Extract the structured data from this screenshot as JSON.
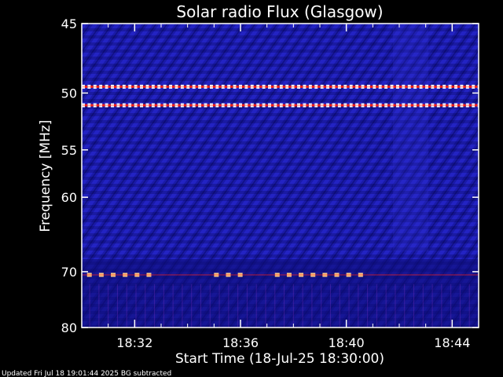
{
  "chart_data": {
    "type": "heatmap",
    "title": "Solar radio Flux (Glasgow)",
    "xlabel": "Start Time (18-Jul-25 18:30:00)",
    "ylabel": "Frequency [MHz]",
    "x_ticks": [
      "18:32",
      "18:36",
      "18:40",
      "18:44"
    ],
    "x_tick_minutes": [
      2,
      6,
      10,
      14
    ],
    "xlim_minutes": [
      0,
      15
    ],
    "y_ticks": [
      45,
      50,
      55,
      60,
      70,
      80
    ],
    "ylim": [
      45,
      80
    ],
    "y_scale": "reciprocal",
    "footer": "Updated Fri Jul 18 19:01:44 2025   BG subtracted",
    "colors": {
      "background": "#000000",
      "plot_base": "#1a1aa8",
      "plot_dark": "#0a0a60",
      "hot": "#ff2010",
      "white": "#ffffff"
    },
    "features": [
      {
        "type": "interference-dashes",
        "freq": 49.5,
        "color": "#ffffff"
      },
      {
        "type": "interference-dashes",
        "freq": 51.0,
        "color": "#ffffff"
      },
      {
        "type": "interference-dashes",
        "freq": 70.5,
        "color": "#ffcc88",
        "segments": [
          [
            0.2,
            2.5
          ],
          [
            5.0,
            6.3
          ],
          [
            7.3,
            10.5
          ]
        ]
      }
    ]
  }
}
